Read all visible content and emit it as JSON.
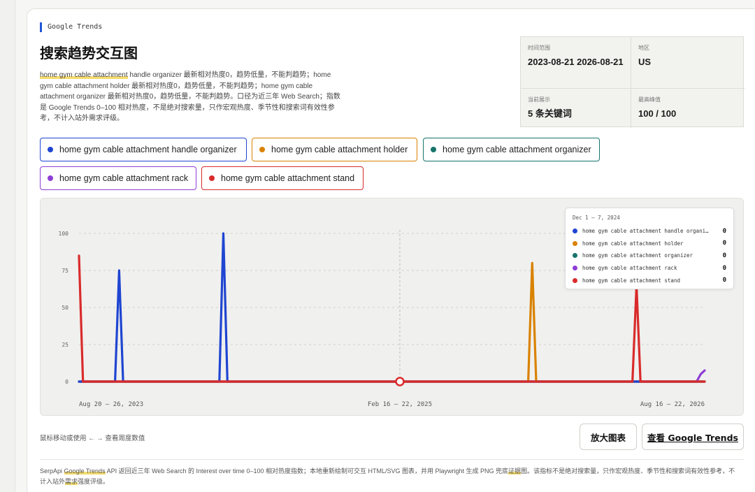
{
  "header": {
    "tag": "Google Trends",
    "title": "搜索趋势交互图",
    "desc_hl": "home gym cable attachment",
    "desc_rest": " handle organizer 最新相对热度0，趋势低量，不能判趋势；home gym cable attachment holder 最新相对热度0，趋势低量，不能判趋势；home gym cable attachment organizer 最新相对热度0，趋势低量，不能判趋势。口径为近三年 Web Search；指数是 Google Trends 0–100 相对热度，不是绝对搜索量，只作宏观热度、季节性和搜索词有效性参考，不计入站外需求评级。"
  },
  "stats": {
    "time_label": "时间范围",
    "time_value": "2023-08-21 2026-08-21",
    "region_label": "地区",
    "region_value": "US",
    "showing_label": "当前展示",
    "showing_value": "5 条关键词",
    "peak_label": "最高峰值",
    "peak_value": "100 / 100"
  },
  "keywords": [
    {
      "label": "home gym cable attachment handle organizer",
      "color": "#1f45d1"
    },
    {
      "label": "home gym cable attachment holder",
      "color": "#d98200"
    },
    {
      "label": "home gym cable attachment organizer",
      "color": "#17736b"
    },
    {
      "label": "home gym cable attachment rack",
      "color": "#8e3ed6"
    },
    {
      "label": "home gym cable attachment stand",
      "color": "#d92b2b"
    }
  ],
  "tooltip": {
    "title": "Dec 1 – 7, 2024",
    "rows": [
      {
        "label": "home gym cable attachment handle organi…",
        "value": "0",
        "color": "#1f45d1"
      },
      {
        "label": "home gym cable attachment holder",
        "value": "0",
        "color": "#d98200"
      },
      {
        "label": "home gym cable attachment organizer",
        "value": "0",
        "color": "#17736b"
      },
      {
        "label": "home gym cable attachment rack",
        "value": "0",
        "color": "#8e3ed6"
      },
      {
        "label": "home gym cable attachment stand",
        "value": "0",
        "color": "#d92b2b"
      }
    ]
  },
  "chart_data": {
    "type": "line",
    "x_tick_labels": [
      "Aug 20 – 26, 2023",
      "Feb 16 – 22, 2025",
      "Aug 16 – 22, 2026"
    ],
    "y_ticks": [
      0,
      25,
      50,
      75,
      100
    ],
    "ylim": [
      0,
      100
    ],
    "weeks": 157,
    "hover_week": 80,
    "series": [
      {
        "name": "home gym cable attachment handle organizer",
        "color": "#1f45d1",
        "points": [
          [
            0,
            0
          ],
          [
            9,
            0
          ],
          [
            10,
            75
          ],
          [
            11,
            0
          ],
          [
            35,
            0
          ],
          [
            36,
            100
          ],
          [
            37,
            0
          ],
          [
            156,
            0
          ]
        ]
      },
      {
        "name": "home gym cable attachment holder",
        "color": "#d98200",
        "points": [
          [
            0,
            0
          ],
          [
            112,
            0
          ],
          [
            113,
            80
          ],
          [
            114,
            0
          ],
          [
            156,
            0
          ]
        ]
      },
      {
        "name": "home gym cable attachment organizer",
        "color": "#17736b",
        "points": [
          [
            0,
            0
          ],
          [
            156,
            0
          ]
        ]
      },
      {
        "name": "home gym cable attachment rack",
        "color": "#8e3ed6",
        "points": [
          [
            0,
            0
          ],
          [
            154,
            0
          ],
          [
            155,
            5
          ],
          [
            156,
            7.5
          ]
        ]
      },
      {
        "name": "home gym cable attachment stand",
        "color": "#d92b2b",
        "points": [
          [
            0,
            85
          ],
          [
            1,
            0
          ],
          [
            138,
            0
          ],
          [
            139,
            65
          ],
          [
            140,
            0
          ],
          [
            156,
            0
          ]
        ]
      }
    ]
  },
  "hint": "鼠标移动或使用 ← → 查看周度数值",
  "buttons": {
    "zoom": "放大图表",
    "trends": "查看 Google Trends"
  },
  "footer": {
    "pre": "SerpApi ",
    "hl1": "Google Trends",
    "mid": " API 返回近三年 Web Search 的 Interest over time 0–100 相对热度指数；本地重新绘制可交互 HTML/SVG 图表，并用 Playwright 生成 PNG 兜底",
    "hl2": "证据",
    "post": "图。该指标不是绝对搜索量，只作宏观热度、季节性和搜索词有效性参考，不计入站外",
    "hl3": "需求",
    "end": "强度评级。"
  }
}
